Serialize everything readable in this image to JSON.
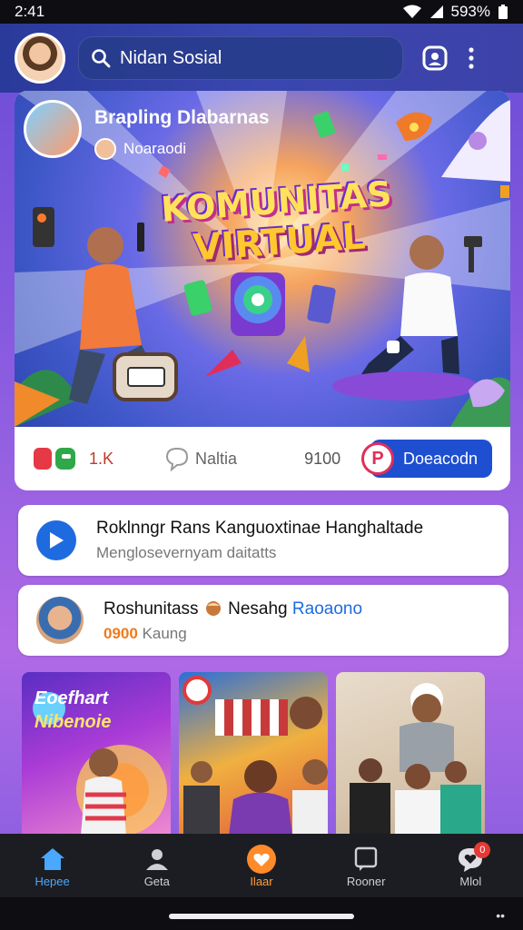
{
  "status_bar": {
    "time": "2:41",
    "battery": "593%"
  },
  "header": {
    "search_text": "Nidan Sosial"
  },
  "post": {
    "author_title": "Brapling Dlabarnas",
    "author_sub": "Noaraodi",
    "hero_line1": "KOMUNITAS",
    "hero_line2": "VIRTUAL",
    "like_count": "1.K",
    "comment_label": "Naltia",
    "share_count": "9100",
    "join_label": "Doeacodn",
    "join_badge": "P"
  },
  "list": [
    {
      "title": "Roklnngr Rans Kanguoxtinae  Hanghaltade",
      "subtitle": "Menglosevernyam daitatts"
    },
    {
      "title_part1": "Roshunitass",
      "title_part2": "Nesahg",
      "title_part3": "Raoaono",
      "sub_number": "0900",
      "sub_text": "Kaung"
    }
  ],
  "tiles": [
    {
      "caption_l1": "Eoefhart",
      "caption_l2": "Nibenoie"
    },
    {},
    {}
  ],
  "bottom_nav": [
    {
      "label": "Hepee",
      "icon": "home-icon"
    },
    {
      "label": "Geta",
      "icon": "person-icon"
    },
    {
      "label": "Ilaar",
      "icon": "heart-chat-icon"
    },
    {
      "label": "Rooner",
      "icon": "chat-square-icon"
    },
    {
      "label": "Mlol",
      "icon": "heart-bubble-icon",
      "badge": "0"
    }
  ],
  "colors": {
    "accent": "#1e4fd0",
    "header": "#3a47b0",
    "nav_active": "#4aa8ff",
    "nav_center": "#ff9e3a"
  }
}
